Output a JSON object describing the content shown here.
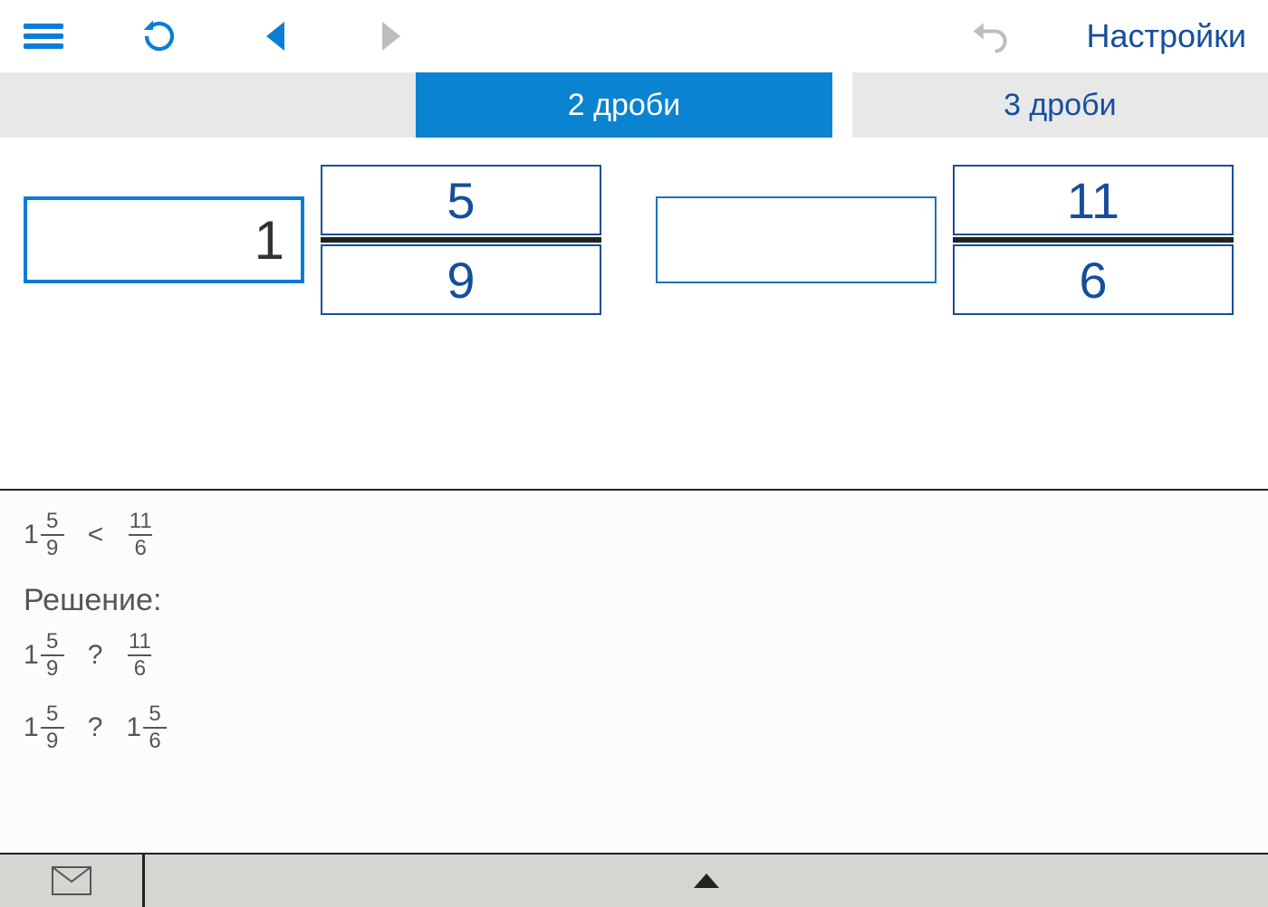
{
  "toolbar": {
    "settings_label": "Настройки"
  },
  "tabs": {
    "two": "2 дроби",
    "three": "3 дроби",
    "active": "two"
  },
  "inputs": {
    "f1": {
      "whole": "1",
      "num": "5",
      "den": "9"
    },
    "f2": {
      "whole": "",
      "num": "11",
      "den": "6"
    }
  },
  "solution": {
    "answer": {
      "left": {
        "w": "1",
        "n": "5",
        "d": "9"
      },
      "op": "<",
      "right": {
        "w": "",
        "n": "11",
        "d": "6"
      }
    },
    "label": "Решение:",
    "steps": [
      {
        "left": {
          "w": "1",
          "n": "5",
          "d": "9"
        },
        "op": "?",
        "right": {
          "w": "",
          "n": "11",
          "d": "6"
        }
      },
      {
        "left": {
          "w": "1",
          "n": "5",
          "d": "9"
        },
        "op": "?",
        "right": {
          "w": "1",
          "n": "5",
          "d": "6"
        }
      }
    ]
  }
}
